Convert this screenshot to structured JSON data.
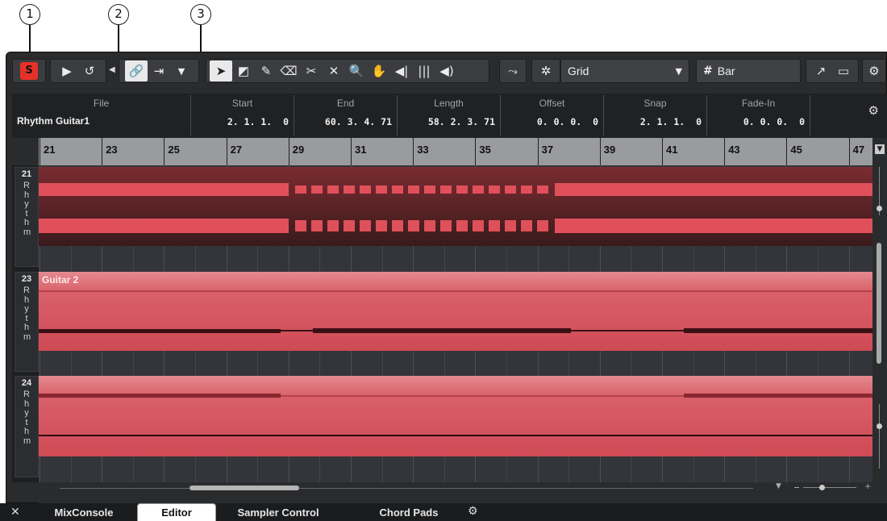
{
  "callouts": [
    "1",
    "2",
    "3"
  ],
  "toolbar": {
    "solo_label": "S",
    "snap_type": "Grid",
    "quantize_label": "Bar"
  },
  "infoline": {
    "file_header": "File",
    "file_value": "Rhythm Guitar1",
    "columns": [
      {
        "header": "Start",
        "value": "2. 1. 1.  0"
      },
      {
        "header": "End",
        "value": "60. 3. 4. 71"
      },
      {
        "header": "Length",
        "value": "58. 2. 3. 71"
      },
      {
        "header": "Offset",
        "value": "0. 0. 0.  0"
      },
      {
        "header": "Snap",
        "value": "2. 1. 1.  0"
      },
      {
        "header": "Fade-In",
        "value": "0. 0. 0.  0"
      }
    ]
  },
  "ruler": {
    "marks": [
      "21",
      "23",
      "25",
      "27",
      "29",
      "31",
      "33",
      "35",
      "37",
      "39",
      "41",
      "43",
      "45",
      "47"
    ]
  },
  "tracks": [
    {
      "number": "21",
      "name": "Rhythm",
      "event_label": ""
    },
    {
      "number": "23",
      "name": "Rhythm",
      "event_label": "Guitar 2"
    },
    {
      "number": "24",
      "name": "Rhythm",
      "event_label": ""
    }
  ],
  "tabs": [
    {
      "label": "MixConsole",
      "active": false
    },
    {
      "label": "Editor",
      "active": true
    },
    {
      "label": "Sampler Control",
      "active": false
    },
    {
      "label": "Chord Pads",
      "active": false
    }
  ],
  "colors": {
    "accent_red": "#e63128",
    "event_red": "#e0505a",
    "background": "#2a2b2d"
  }
}
